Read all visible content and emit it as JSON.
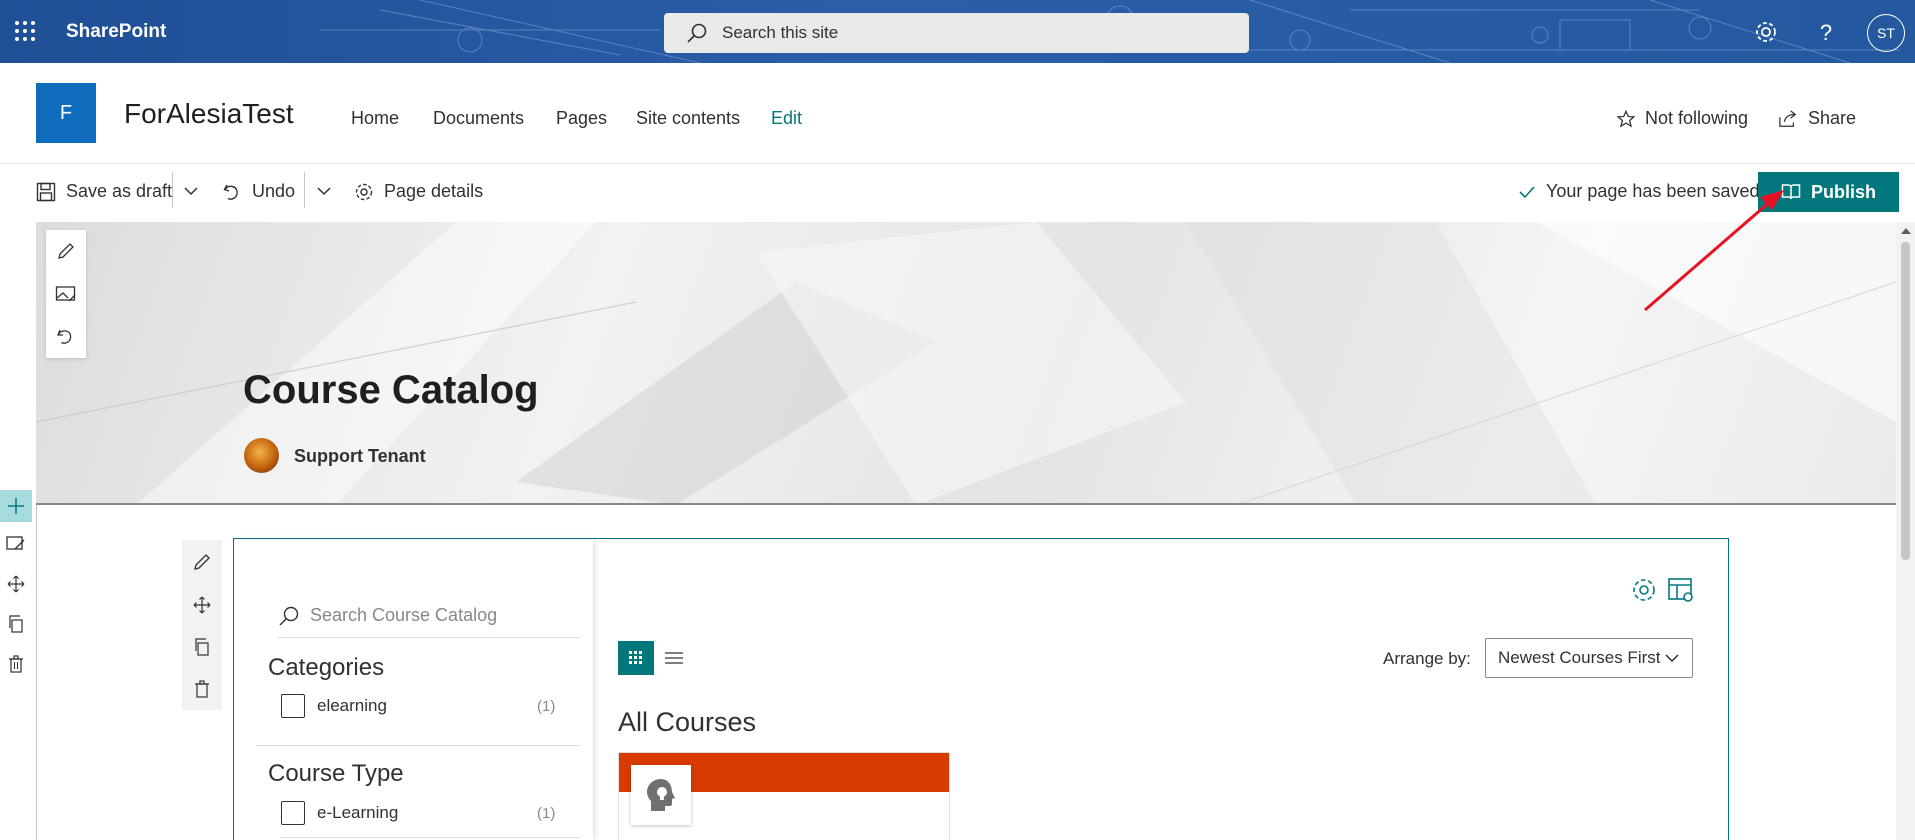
{
  "suite_bar": {
    "brand": "SharePoint",
    "search_placeholder": "Search this site",
    "user_initials": "ST"
  },
  "site_header": {
    "logo_letter": "F",
    "site_name": "ForAlesiaTest",
    "nav": [
      "Home",
      "Documents",
      "Pages",
      "Site contents",
      "Edit"
    ],
    "follow_label": "Not following",
    "share_label": "Share"
  },
  "command_bar": {
    "save_draft": "Save as draft",
    "undo": "Undo",
    "page_details": "Page details",
    "saved_status": "Your page has been saved",
    "publish": "Publish"
  },
  "hero": {
    "title": "Course Catalog",
    "author": "Support Tenant"
  },
  "catalog": {
    "search_placeholder": "Search Course Catalog",
    "filters": [
      {
        "heading": "Categories",
        "items": [
          {
            "label": "elearning",
            "count": "(1)"
          }
        ]
      },
      {
        "heading": "Course Type",
        "items": [
          {
            "label": "e-Learning",
            "count": "(1)"
          }
        ]
      }
    ],
    "arrange_label": "Arrange by:",
    "arrange_value": "Newest Courses First",
    "section_title": "All Courses"
  },
  "colors": {
    "accent": "#03787c",
    "suite_bar": "#24589f",
    "card_band": "#d83b01",
    "annotation_arrow": "#e81123"
  }
}
